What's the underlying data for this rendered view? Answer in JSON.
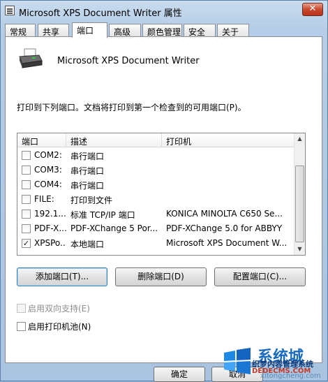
{
  "window": {
    "title": "Microsoft XPS Document Writer 属性",
    "close_glyph": "✕"
  },
  "tabs": [
    {
      "label": "常规"
    },
    {
      "label": "共享"
    },
    {
      "label": "端口"
    },
    {
      "label": "高级"
    },
    {
      "label": "颜色管理"
    },
    {
      "label": "安全"
    },
    {
      "label": "关于"
    }
  ],
  "active_tab": "端口",
  "printer": {
    "name": "Microsoft XPS Document Writer"
  },
  "description": "打印到下列端口。文档将打印到第一个检查到的可用端口(P)。",
  "port_list": {
    "columns": [
      "端口",
      "描述",
      "打印机"
    ],
    "rows": [
      {
        "checked": false,
        "port": "COM2:",
        "desc": "串行端口",
        "printer": ""
      },
      {
        "checked": false,
        "port": "COM3:",
        "desc": "串行端口",
        "printer": ""
      },
      {
        "checked": false,
        "port": "COM4:",
        "desc": "串行端口",
        "printer": ""
      },
      {
        "checked": false,
        "port": "FILE:",
        "desc": "打印到文件",
        "printer": ""
      },
      {
        "checked": false,
        "port": "192.1...",
        "desc": "标准 TCP/IP 端口",
        "printer": "KONICA MINOLTA C650 Se..."
      },
      {
        "checked": false,
        "port": "PDF-X...",
        "desc": "PDF-XChange 5 Por...",
        "printer": "PDF-XChange 5.0 for ABBYY"
      },
      {
        "checked": true,
        "port": "XPSPo...",
        "desc": "本地端口",
        "printer": "Microsoft XPS Document W..."
      }
    ],
    "check_glyph": "✓"
  },
  "buttons": {
    "add_port": "添加端口(T)...",
    "delete_port": "删除端口(D)",
    "configure_port": "配置端口(C)..."
  },
  "options": {
    "bidirectional": {
      "label": "启用双向支持(E)",
      "checked": false,
      "enabled": false
    },
    "pooling": {
      "label": "启用打印机池(N)",
      "checked": false,
      "enabled": true
    }
  },
  "footer": {
    "ok": "确定",
    "cancel": "取消"
  },
  "watermark": {
    "line1": "系统城",
    "line2": "织梦内容管理系统",
    "line3": "DEDECMS.COM",
    "line4": "xitongcheng.com"
  }
}
